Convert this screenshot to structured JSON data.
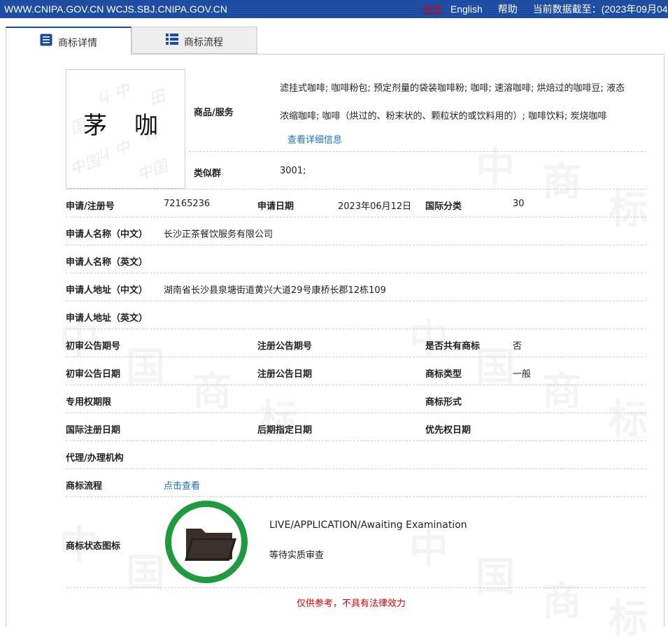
{
  "topbar": {
    "site": "WWW.CNIPA.GOV.CN WCJS.SBJ.CNIPA.GOV.CN",
    "lang_zh": "中文",
    "lang_en": "English",
    "help": "帮助",
    "date": "当前数据截至：(2023年09月04"
  },
  "tabs": [
    {
      "label": "商标详情",
      "icon": "list-icon"
    },
    {
      "label": "商标流程",
      "icon": "grid-icon"
    }
  ],
  "logo": {
    "text": "茅 咖"
  },
  "goods": {
    "label": "商品/服务",
    "line1": "滤挂式咖啡; 咖啡粉包; 预定剂量的袋装咖啡粉; 咖啡; 速溶咖啡; 烘焙过的咖啡豆; 液态",
    "line2": "浓缩咖啡; 咖啡（烘过的、粉末状的、颗粒状的或饮料用的）; 咖啡饮料; 炭烧咖啡",
    "detail_link": "查看详细信息"
  },
  "similar": {
    "label": "类似群",
    "value": "3001;"
  },
  "rows": {
    "reg_no_label": "申请/注册号",
    "reg_no": "72165236",
    "app_date_label": "申请日期",
    "app_date": "2023年06月12日",
    "intl_class_label": "国际分类",
    "intl_class": "30",
    "applicant_cn_label": "申请人名称（中文）",
    "applicant_cn": "长沙正茶餐饮服务有限公司",
    "applicant_en_label": "申请人名称（英文）",
    "address_cn_label": "申请人地址（中文）",
    "address_cn": "湖南省长沙县泉塘街道黄兴大道29号康桥长郡12栋109",
    "address_en_label": "申请人地址（英文）",
    "prelim_no_label": "初审公告期号",
    "reg_notice_no_label": "注册公告期号",
    "shared_label": "是否共有商标",
    "shared": "否",
    "prelim_date_label": "初审公告日期",
    "reg_notice_date_label": "注册公告日期",
    "tm_type_label": "商标类型",
    "tm_type": "一般",
    "exclusive_label": "专用权期限",
    "tm_form_label": "商标形式",
    "intl_reg_date_label": "国际注册日期",
    "later_date_label": "后期指定日期",
    "priority_date_label": "优先权日期",
    "agent_label": "代理/办理机构",
    "process_label": "商标流程",
    "process_link": "点击查看",
    "status_label": "商标状态图标"
  },
  "status": {
    "en": "LIVE/APPLICATION/Awaiting Examination",
    "cn": "等待实质审查",
    "ring_color": "#1f9a3e",
    "icon": "folder-icon"
  },
  "disclaimer": "仅供参考，不具有法律效力",
  "colors": {
    "header_bg": "#1a4aa0",
    "link": "#1a6fc2",
    "warn": "#e00000"
  }
}
